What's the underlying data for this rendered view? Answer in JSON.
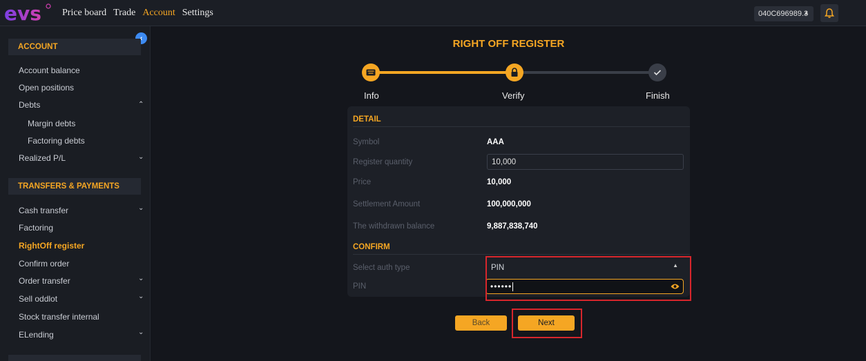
{
  "topbar": {
    "logo_text": "evs",
    "nav": [
      "Price board",
      "Trade",
      "Account",
      "Settings"
    ],
    "active_nav": "Account",
    "account_select_value": "040C696989.3",
    "accent_color": "#f5a623"
  },
  "sidebar": {
    "section_account": "ACCOUNT",
    "items_account": [
      "Account balance",
      "Open positions",
      "Debts",
      "Margin debts",
      "Factoring debts",
      "Realized P/L"
    ],
    "section_transfers": "TRANSFERS & PAYMENTS",
    "items_transfers": [
      "Cash transfer",
      "Factoring",
      "RightOff register",
      "Confirm order",
      "Order transfer",
      "Sell oddlot",
      "Stock transfer internal",
      "ELending"
    ],
    "active_item": "RightOff register"
  },
  "main": {
    "title": "RIGHT OFF REGISTER",
    "steps": [
      "Info",
      "Verify",
      "Finish"
    ],
    "detail": {
      "header": "DETAIL",
      "symbol_label": "Symbol",
      "symbol_value": "AAA",
      "quantity_label": "Register quantity",
      "quantity_value": "10,000",
      "price_label": "Price",
      "price_value": "10,000",
      "settlement_label": "Settlement Amount",
      "settlement_value": "100,000,000",
      "balance_label": "The withdrawn balance",
      "balance_value": "9,887,838,740"
    },
    "confirm": {
      "header": "CONFIRM",
      "auth_label": "Select auth type",
      "auth_value": "PIN",
      "pin_label": "PIN",
      "pin_value": "••••••"
    },
    "buttons": {
      "back": "Back",
      "next": "Next"
    }
  }
}
